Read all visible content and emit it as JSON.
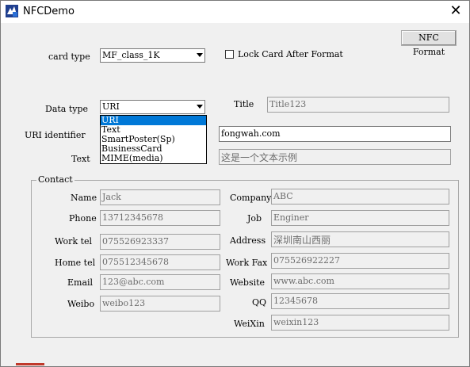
{
  "window": {
    "title": "NFCDemo",
    "close_glyph": "✕"
  },
  "buttons": {
    "nfc_format": "NFC Format"
  },
  "card_type": {
    "label": "card type",
    "value": "MF_class_1K"
  },
  "lock_card": {
    "label": "Lock Card After Format",
    "checked": false
  },
  "data_type": {
    "label": "Data type",
    "value": "URI",
    "options": [
      "URI",
      "Text",
      "SmartPoster(Sp)",
      "BusinessCard",
      "MIME(media)"
    ],
    "selected_index": 0
  },
  "title_field": {
    "label": "Title",
    "value": "Title123"
  },
  "uri_identifier": {
    "label": "URI identifier",
    "value": "fongwah.com"
  },
  "text_field": {
    "label": "Text",
    "value": "这是一个文本示例"
  },
  "contact": {
    "group_label": "Contact",
    "left": [
      {
        "label": "Name",
        "value": "Jack"
      },
      {
        "label": "Phone",
        "value": "13712345678"
      },
      {
        "label": "Work tel",
        "value": "075526923337"
      },
      {
        "label": "Home tel",
        "value": "075512345678"
      },
      {
        "label": "Email",
        "value": "123@abc.com"
      },
      {
        "label": "Weibo",
        "value": "weibo123"
      }
    ],
    "right": [
      {
        "label": "Company",
        "value": "ABC"
      },
      {
        "label": "Job",
        "value": "Enginer"
      },
      {
        "label": "Address",
        "value": "深圳南山西丽"
      },
      {
        "label": "Work Fax",
        "value": "075526922227"
      },
      {
        "label": "Website",
        "value": "www.abc.com"
      },
      {
        "label": "QQ",
        "value": "12345678"
      },
      {
        "label": "WeiXin",
        "value": "weixin123"
      }
    ]
  },
  "icons": {
    "app": "nfc-app-icon",
    "close": "close-icon",
    "dropdown": "chevron-down-icon"
  }
}
